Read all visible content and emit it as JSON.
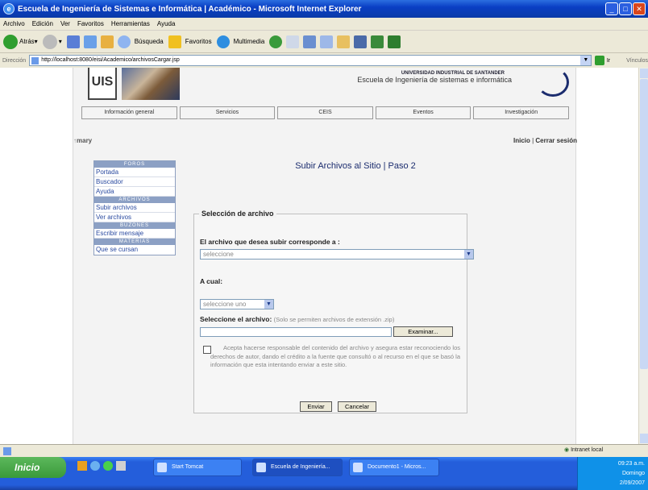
{
  "window": {
    "title": "Escuela de Ingeniería de Sistemas e Informática | Académico - Microsoft Internet Explorer"
  },
  "menu": [
    "Archivo",
    "Edición",
    "Ver",
    "Favoritos",
    "Herramientas",
    "Ayuda"
  ],
  "toolbar": {
    "back": "Atrás",
    "search": "Búsqueda",
    "favorites": "Favoritos",
    "multimedia": "Multimedia"
  },
  "address": {
    "label": "Dirección",
    "url": "http://localhost:8080/eisi/Academico/archivosCargar.jsp",
    "go": "Ir",
    "links": "Vínculos"
  },
  "header": {
    "logo_text": "UIS",
    "university": "UNIVERSIDAD INDUSTRIAL DE SANTANDER",
    "school": "Escuela de Ingeniería de sistemas e informática"
  },
  "nav": [
    "Información general",
    "Servicios",
    "CEIS",
    "Eventos",
    "Investigación"
  ],
  "user": {
    "name": "mary",
    "home": "Inicio",
    "separator": " | ",
    "logout": "Cerrar sesión"
  },
  "sidebar": {
    "sections": [
      {
        "title": "FOROS",
        "items": [
          "Portada",
          "Buscador",
          "Ayuda"
        ]
      },
      {
        "title": "ARCHIVOS",
        "items": [
          "Subir archivos",
          "Ver archivos"
        ]
      },
      {
        "title": "BUZONES",
        "items": [
          "Escribir mensaje"
        ]
      },
      {
        "title": "MATERIAS",
        "items": [
          "Que se cursan"
        ]
      }
    ]
  },
  "main": {
    "title": "Subir Archivos al Sitio | Paso 2",
    "fieldset_legend": "Selección de archivo",
    "q1_label": "El archivo que desea subir corresponde a :",
    "q1_value": "seleccione",
    "q2_label": "A cual:",
    "q2_value": "seleccione uno",
    "file_label": "Seleccione el archivo:",
    "file_note": "(Solo se permiten archivos de extensión .zip)",
    "browse_button": "Examinar...",
    "terms": "Acepta hacerse responsable del contenido del archivo y asegura estar reconociendo los derechos de autor, dando el crédito a la fuente que consultó o al recurso en el que se basó la información que esta intentando enviar a este sitio.",
    "submit_button": "Enviar",
    "cancel_button": "Cancelar"
  },
  "status": {
    "zone": "Intranet local"
  },
  "taskbar": {
    "start": "Inicio",
    "tasks": [
      "Start Tomcat",
      "Escuela de Ingeniería...",
      "Documento1 - Micros..."
    ],
    "clock": "09:23 a.m.",
    "day": "Domingo",
    "date": "2/09/2007"
  },
  "colors": {
    "accent": "#1b2c6e",
    "link": "#2a4aa0",
    "sidebar_header": "#8ca0c4"
  }
}
